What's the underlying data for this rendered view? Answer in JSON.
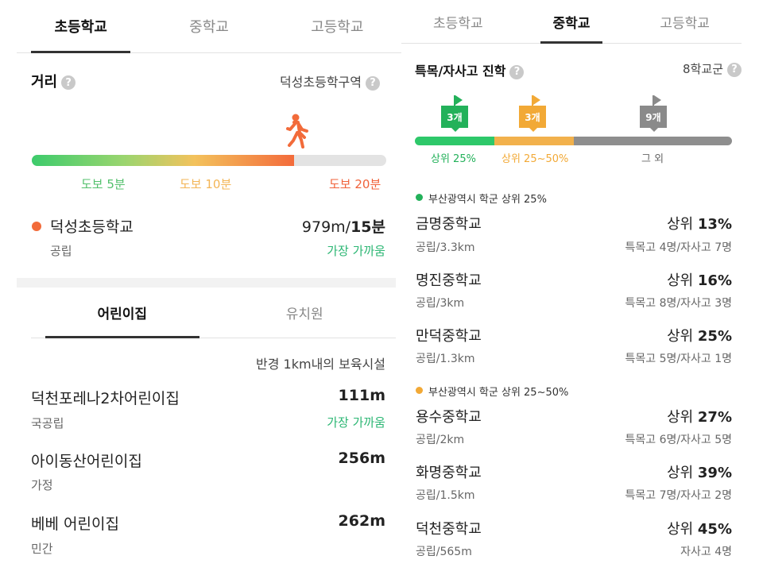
{
  "left": {
    "tabs": [
      {
        "label": "초등학교",
        "active": true
      },
      {
        "label": "중학교",
        "active": false
      },
      {
        "label": "고등학교",
        "active": false
      }
    ],
    "distance": {
      "title": "거리",
      "district": "덕성초등학구역",
      "progress": 0.74,
      "ticks": [
        "도보 5분",
        "도보 10분",
        "도보 20분"
      ]
    },
    "school": {
      "name": "덕성초등학교",
      "type": "공립",
      "distance": "979m/",
      "minutes": "15분",
      "nearest": "가장 가까움"
    },
    "childcare_tabs": [
      {
        "label": "어린이집",
        "active": true
      },
      {
        "label": "유치원",
        "active": false
      }
    ],
    "radius_note": "반경 1km내의 보육시설",
    "childcare": [
      {
        "name": "덕천포레나2차어린이집",
        "type": "국공립",
        "distance": "111m",
        "note": "가장 가까움"
      },
      {
        "name": "아이동산어린이집",
        "type": "가정",
        "distance": "256m",
        "note": ""
      },
      {
        "name": "베베 어린이집",
        "type": "민간",
        "distance": "262m",
        "note": ""
      }
    ]
  },
  "right": {
    "tabs": [
      {
        "label": "초등학교",
        "active": false
      },
      {
        "label": "중학교",
        "active": true
      },
      {
        "label": "고등학교",
        "active": false
      }
    ],
    "title": "특목/자사고 진학",
    "district": "8학교군",
    "flags": [
      {
        "count": "3개",
        "color": "#23b15a"
      },
      {
        "count": "3개",
        "color": "#f2a936"
      },
      {
        "count": "9개",
        "color": "#8a8a8a"
      }
    ],
    "segments": [
      {
        "label": "상위 25%",
        "color": "#2ec86a"
      },
      {
        "label": "상위 25~50%",
        "color": "#f2b14c"
      },
      {
        "label": "그 외",
        "color": "#8e8e8e"
      }
    ],
    "groups": [
      {
        "label": "부산광역시 학군 상위 25%",
        "color": "#23b15a",
        "schools": [
          {
            "name": "금명중학교",
            "sub": "공립/3.3km",
            "rank_prefix": "상위 ",
            "rank": "13%",
            "meta": "특목고 4명/자사고 7명"
          },
          {
            "name": "명진중학교",
            "sub": "공립/3km",
            "rank_prefix": "상위 ",
            "rank": "16%",
            "meta": "특목고 8명/자사고 3명"
          },
          {
            "name": "만덕중학교",
            "sub": "공립/1.3km",
            "rank_prefix": "상위 ",
            "rank": "25%",
            "meta": "특목고 5명/자사고 1명"
          }
        ]
      },
      {
        "label": "부산광역시 학군 상위 25~50%",
        "color": "#f2a936",
        "schools": [
          {
            "name": "용수중학교",
            "sub": "공립/2km",
            "rank_prefix": "상위 ",
            "rank": "27%",
            "meta": "특목고 6명/자사고 5명"
          },
          {
            "name": "화명중학교",
            "sub": "공립/1.5km",
            "rank_prefix": "상위 ",
            "rank": "39%",
            "meta": "특목고 7명/자사고 2명"
          },
          {
            "name": "덕천중학교",
            "sub": "공립/565m",
            "rank_prefix": "상위 ",
            "rank": "45%",
            "meta": "자사고 4명"
          }
        ]
      }
    ]
  },
  "colors": {
    "accent_green": "#2bb673",
    "orange": "#f26b3a",
    "tick_green": "#53c06c",
    "tick_yellow": "#f3b556",
    "tick_red": "#f0623a"
  },
  "icons": [
    "help-icon",
    "walking-person-icon",
    "flag-icon"
  ]
}
